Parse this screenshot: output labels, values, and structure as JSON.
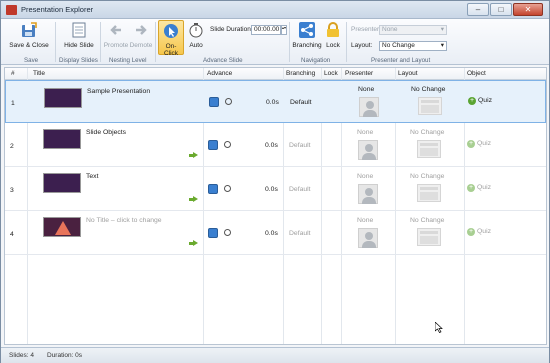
{
  "window": {
    "title": "Presentation Explorer",
    "minimize": "–",
    "maximize": "□",
    "close": "✕"
  },
  "ribbon": {
    "save_close": "Save & Close",
    "hide_slide": "Hide Slide",
    "promote": "Promote",
    "demote": "Demote",
    "on_click": "On-Click",
    "auto": "Auto",
    "slide_duration_label": "Slide Duration:",
    "slide_duration_value": "00:00.00",
    "branching": "Branching",
    "lock": "Lock",
    "presenter_label": "Presenter",
    "presenter_value": "None",
    "layout_label": "Layout:",
    "layout_value": "No Change",
    "groups": {
      "save": "Save",
      "display": "Display Slides",
      "nesting": "Nesting Level",
      "advance": "Advance Slide",
      "navigation": "Navigation",
      "presenter_layout": "Presenter and Layout"
    }
  },
  "columns": [
    "#",
    "Title",
    "Advance",
    "Branching",
    "Lock",
    "Presenter",
    "Layout",
    "Object"
  ],
  "rows": [
    {
      "num": "1",
      "title": "Sample Presentation",
      "time": "0.0s",
      "branching": "Default",
      "presenter": "None",
      "layout": "No Change",
      "object": "Quiz"
    },
    {
      "num": "2",
      "title": "Slide Objects",
      "time": "0.0s",
      "branching": "Default",
      "presenter": "None",
      "layout": "No Change",
      "object": "Quiz"
    },
    {
      "num": "3",
      "title": "Text",
      "time": "0.0s",
      "branching": "Default",
      "presenter": "None",
      "layout": "No Change",
      "object": "Quiz"
    },
    {
      "num": "4",
      "title": "No Title – click to change",
      "time": "0.0s",
      "branching": "Default",
      "presenter": "None",
      "layout": "No Change",
      "object": "Quiz"
    }
  ],
  "status": {
    "slides": "Slides: 4",
    "duration": "Duration: 0s"
  },
  "colors": {
    "accent": "#3a7fd0",
    "selected_row": "#e6f1fb",
    "on_click": "#f6c74d",
    "quiz_green": "#5aa432"
  }
}
